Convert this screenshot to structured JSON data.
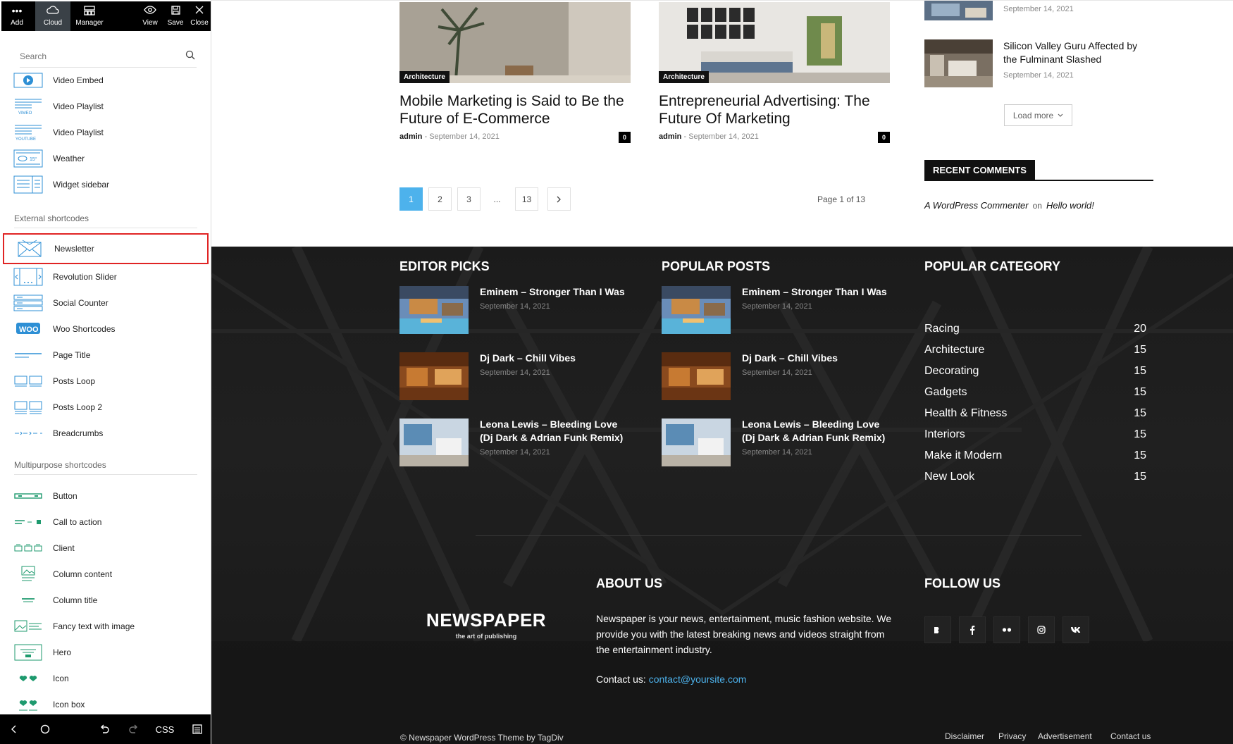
{
  "editor": {
    "toolbar": {
      "add": "Add",
      "cloud": "Cloud",
      "manager": "Manager",
      "view": "View",
      "save": "Save",
      "close": "Close"
    },
    "search": {
      "placeholder": "Search"
    },
    "items_top": [
      {
        "label": "Video Embed",
        "icon": "video-embed-icon"
      },
      {
        "label": "Video Playlist",
        "icon": "vimeo-playlist-icon",
        "tag": "VIMEO"
      },
      {
        "label": "Video Playlist",
        "icon": "youtube-playlist-icon",
        "tag": "YOUTUBE"
      },
      {
        "label": "Weather",
        "icon": "weather-icon"
      },
      {
        "label": "Widget sidebar",
        "icon": "widget-sidebar-icon"
      }
    ],
    "section_external": "External shortcodes",
    "items_external": [
      {
        "label": "Newsletter",
        "icon": "newsletter-icon",
        "selected": true
      },
      {
        "label": "Revolution Slider",
        "icon": "revolution-slider-icon"
      },
      {
        "label": "Social Counter",
        "icon": "social-counter-icon"
      },
      {
        "label": "Woo Shortcodes",
        "icon": "woo-icon",
        "tag": "WOO"
      },
      {
        "label": "Page Title",
        "icon": "page-title-icon"
      },
      {
        "label": "Posts Loop",
        "icon": "posts-loop-icon"
      },
      {
        "label": "Posts Loop 2",
        "icon": "posts-loop-2-icon"
      },
      {
        "label": "Breadcrumbs",
        "icon": "breadcrumbs-icon"
      }
    ],
    "section_multipurpose": "Multipurpose shortcodes",
    "items_multi": [
      {
        "label": "Button",
        "icon": "button-icon"
      },
      {
        "label": "Call to action",
        "icon": "call-to-action-icon"
      },
      {
        "label": "Client",
        "icon": "client-icon"
      },
      {
        "label": "Column content",
        "icon": "column-content-icon"
      },
      {
        "label": "Column title",
        "icon": "column-title-icon"
      },
      {
        "label": "Fancy text with image",
        "icon": "fancy-text-icon"
      },
      {
        "label": "Hero",
        "icon": "hero-icon"
      },
      {
        "label": "Icon",
        "icon": "heart-icon"
      },
      {
        "label": "Icon box",
        "icon": "icon-box-icon"
      }
    ],
    "bottombar": {
      "css": "CSS"
    },
    "colors": {
      "accent_green": "#1e9a6e",
      "accent_blue": "#2d8fd5",
      "selected_border": "#e02424"
    }
  },
  "main": {
    "cards": [
      {
        "category": "Architecture",
        "title": "Mobile Marketing is Said to Be the Future of E-Commerce",
        "author": "admin",
        "date": "September 14, 2021",
        "comments": "0"
      },
      {
        "category": "Architecture",
        "title": "Entrepreneurial Advertising: The Future Of Marketing",
        "author": "admin",
        "date": "September 14, 2021",
        "comments": "0"
      }
    ],
    "pagination": {
      "pages": [
        "1",
        "2",
        "3",
        "...",
        "13"
      ],
      "current": "1",
      "next": "›",
      "summary": "Page 1 of 13"
    },
    "sidebar": {
      "first_date": "September 14, 2021",
      "post_title": "Silicon Valley Guru Affected by the Fulminant Slashed",
      "post_date": "September 14, 2021",
      "load_more": "Load more",
      "recent_comments_title": "RECENT COMMENTS",
      "comment_author": "A WordPress Commenter",
      "comment_on": "on",
      "comment_post": "Hello world!"
    },
    "accent_color": "#4db2ec"
  },
  "footer": {
    "editor_picks": {
      "title": "EDITOR PICKS",
      "posts": [
        {
          "title": "Eminem – Stronger Than I Was",
          "date": "September 14, 2021"
        },
        {
          "title": "Dj Dark – Chill Vibes",
          "date": "September 14, 2021"
        },
        {
          "title": "Leona Lewis – Bleeding Love (Dj Dark & Adrian Funk Remix)",
          "date": "September 14, 2021"
        }
      ]
    },
    "popular_posts": {
      "title": "POPULAR POSTS",
      "posts": [
        {
          "title": "Eminem – Stronger Than I Was",
          "date": "September 14, 2021"
        },
        {
          "title": "Dj Dark – Chill Vibes",
          "date": "September 14, 2021"
        },
        {
          "title": "Leona Lewis – Bleeding Love (Dj Dark & Adrian Funk Remix)",
          "date": "September 14, 2021"
        }
      ]
    },
    "popular_category": {
      "title": "POPULAR CATEGORY",
      "items": [
        {
          "name": "Racing",
          "count": "20"
        },
        {
          "name": "Architecture",
          "count": "15"
        },
        {
          "name": "Decorating",
          "count": "15"
        },
        {
          "name": "Gadgets",
          "count": "15"
        },
        {
          "name": "Health & Fitness",
          "count": "15"
        },
        {
          "name": "Interiors",
          "count": "15"
        },
        {
          "name": "Make it Modern",
          "count": "15"
        },
        {
          "name": "New Look",
          "count": "15"
        }
      ]
    },
    "logo": {
      "main": "NEWSPAPER",
      "sub": "the art of publishing"
    },
    "about": {
      "title": "ABOUT US",
      "text": "Newspaper is your news, entertainment, music fashion website. We provide you with the latest breaking news and videos straight from the entertainment industry.",
      "contact_label": "Contact us:",
      "contact_email": "contact@yoursite.com"
    },
    "follow": {
      "title": "FOLLOW US",
      "networks": [
        "behance-icon",
        "facebook-icon",
        "flickr-icon",
        "instagram-icon",
        "vk-icon"
      ]
    },
    "copyright": "© Newspaper WordPress Theme by TagDiv",
    "links": [
      "Disclaimer",
      "Privacy",
      "Advertisement",
      "Contact us"
    ]
  }
}
